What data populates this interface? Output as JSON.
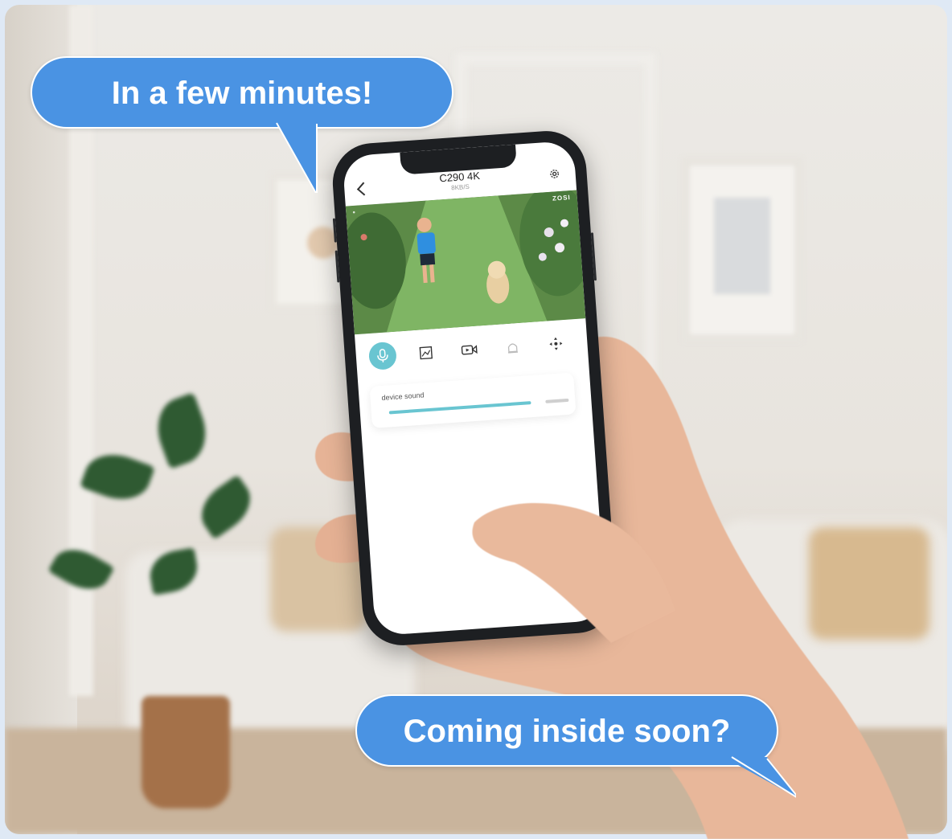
{
  "bubbles": {
    "top": "In a few minutes!",
    "bottom": "Coming inside soon?"
  },
  "app": {
    "camera_name": "C290 4K",
    "bitrate": "8KB/S",
    "brand": "ZOSI",
    "toolbar": [
      {
        "name": "microphone",
        "icon": "microphone-icon",
        "active": true
      },
      {
        "name": "screenshot",
        "icon": "image-capture-icon",
        "active": false
      },
      {
        "name": "record",
        "icon": "video-record-icon",
        "active": false
      },
      {
        "name": "siren",
        "icon": "siren-icon",
        "active": false
      },
      {
        "name": "ptz",
        "icon": "ptz-control-icon",
        "active": false
      }
    ],
    "device_sound_label": "device sound",
    "device_sound_level": 0.87
  },
  "colors": {
    "bubble": "#4a93e3",
    "accent": "#69c5d1"
  }
}
